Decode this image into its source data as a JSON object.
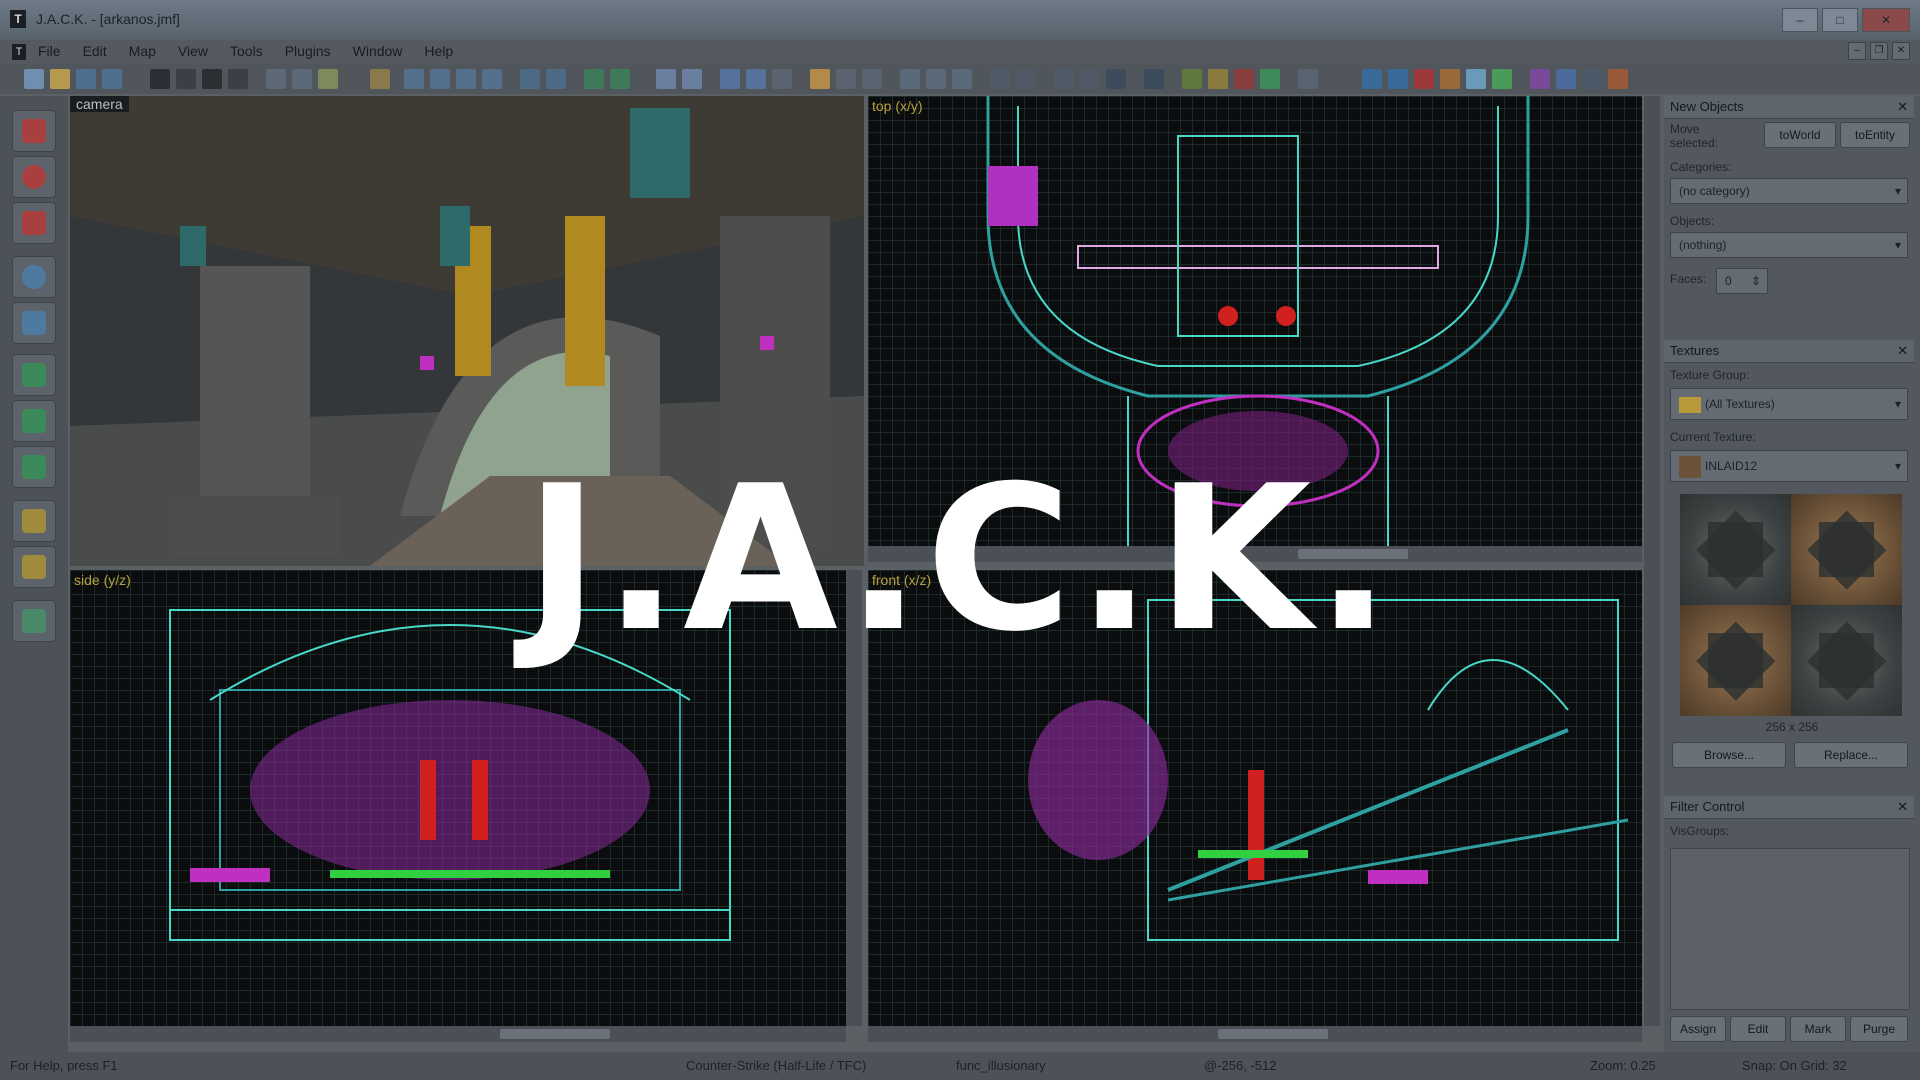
{
  "window": {
    "title": "J.A.C.K. - [arkanos.jmf]",
    "app_icon": "T"
  },
  "menu": {
    "items": [
      "File",
      "Edit",
      "Map",
      "View",
      "Tools",
      "Plugins",
      "Window",
      "Help"
    ]
  },
  "viewports": {
    "camera": {
      "label": "camera"
    },
    "top": {
      "label": "top (x/y)"
    },
    "side": {
      "label": "side (y/z)"
    },
    "front": {
      "label": "front (x/z)"
    }
  },
  "new_objects": {
    "header": "New Objects",
    "move_selected_label": "Move selected:",
    "to_world": "toWorld",
    "to_entity": "toEntity",
    "categories_label": "Categories:",
    "categories_value": "(no category)",
    "objects_label": "Objects:",
    "objects_value": "(nothing)",
    "faces_label": "Faces:",
    "faces_value": "0"
  },
  "textures": {
    "header": "Textures",
    "group_label": "Texture Group:",
    "group_value": "(All Textures)",
    "current_label": "Current Texture:",
    "current_value": "INLAID12",
    "size": "256 x 256",
    "browse": "Browse...",
    "replace": "Replace..."
  },
  "filter_control": {
    "header": "Filter Control",
    "visgroups_label": "VisGroups:",
    "assign": "Assign",
    "edit": "Edit",
    "mark": "Mark",
    "purge": "Purge"
  },
  "status": {
    "help": "For Help, press F1",
    "game": "Counter-Strike (Half-Life / TFC)",
    "entity": "func_illusionary",
    "coords": "@-256, -512",
    "zoom": "Zoom: 0.25",
    "snap": "Snap: On Grid: 32"
  },
  "overlay": {
    "title": "J.A.C.K."
  }
}
